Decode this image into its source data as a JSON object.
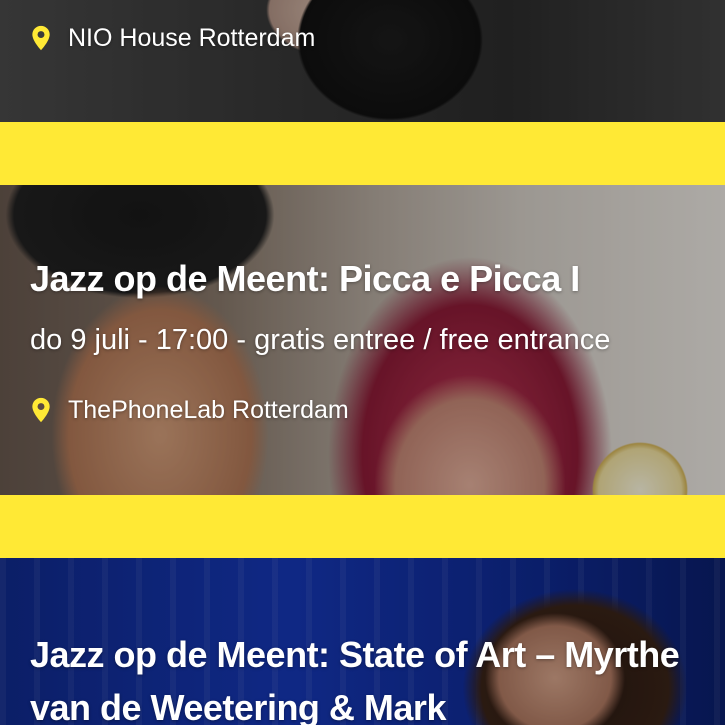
{
  "events": [
    {
      "location": "NIO House Rotterdam"
    },
    {
      "title": "Jazz op de Meent: Picca e Picca I",
      "meta": "do 9 juli - 17:00 - gratis entree / free entrance",
      "location": "ThePhoneLab Rotterdam"
    },
    {
      "title": "Jazz op de Meent: State of Art – Myrthe van de Weetering & Mark"
    }
  ],
  "colors": {
    "accent_yellow": "#ffe935",
    "pin": "#ffe935",
    "text": "#ffffff"
  },
  "icons": {
    "location": "map-pin-icon"
  }
}
